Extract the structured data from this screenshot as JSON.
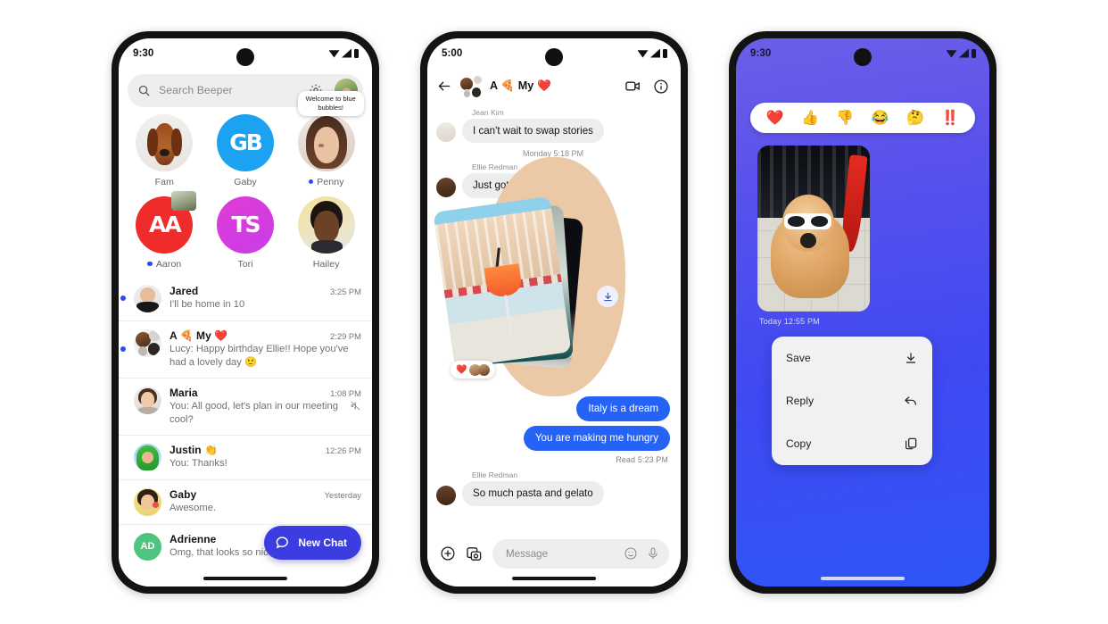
{
  "phone1": {
    "status": {
      "time": "9:30",
      "icons": [
        "wifi-icon",
        "signal-icon",
        "battery-icon"
      ]
    },
    "search": {
      "placeholder": "Search Beeper",
      "icon": "search-icon",
      "settings_icon": "gear-icon",
      "avatar": "profile-avatar"
    },
    "pinned": [
      {
        "name": "Fam",
        "type": "photo",
        "unread": false,
        "badge": null
      },
      {
        "name": "Gaby",
        "type": "initials",
        "initials": "GB",
        "color": "#1ba2f0",
        "unread": false,
        "badge": null
      },
      {
        "name": "Penny",
        "type": "photo",
        "unread": true,
        "badge": "Welcome to blue bubbles!"
      },
      {
        "name": "Aaron",
        "type": "initials",
        "initials": "AA",
        "color": "#ef2b2b",
        "unread": true,
        "badge": null,
        "overlay": "mini-photo"
      },
      {
        "name": "Tori",
        "type": "initials",
        "initials": "TS",
        "color": "#e33bdd",
        "unread": false,
        "badge": null
      },
      {
        "name": "Hailey",
        "type": "photo",
        "unread": false,
        "badge": null
      }
    ],
    "chats": [
      {
        "name": "Jared",
        "time": "3:25 PM",
        "preview": "I'll be home in 10",
        "unread": true,
        "muted": false,
        "avatar_type": "photo"
      },
      {
        "name": "A 🍕 My ❤️",
        "time": "2:29 PM",
        "preview": "Lucy: Happy birthday Ellie!! Hope you've had a lovely day  🙂",
        "unread": true,
        "muted": false,
        "avatar_type": "group"
      },
      {
        "name": "Maria",
        "time": "1:08 PM",
        "preview": "You: All good, let's plan in our meeting cool?",
        "unread": false,
        "muted": true,
        "avatar_type": "photo"
      },
      {
        "name": "Justin 👏",
        "time": "12:26 PM",
        "preview": "You: Thanks!",
        "unread": false,
        "muted": false,
        "avatar_type": "photo"
      },
      {
        "name": "Gaby",
        "time": "Yesterday",
        "preview": "Awesome.",
        "unread": false,
        "muted": false,
        "avatar_type": "photo"
      },
      {
        "name": "Adrienne",
        "time": "",
        "preview": "Omg, that looks so nice!",
        "unread": false,
        "muted": false,
        "avatar_type": "initials",
        "initials": "AD",
        "color": "#4fc47f"
      }
    ],
    "fab": {
      "label": "New Chat",
      "icon": "chat-bubble-icon",
      "color": "#3b3de0"
    }
  },
  "phone2": {
    "status": {
      "time": "5:00"
    },
    "header": {
      "title": "A 🍕 My ❤️",
      "back_icon": "back-arrow-icon",
      "video_icon": "video-call-icon",
      "info_icon": "info-icon"
    },
    "messages": [
      {
        "kind": "incoming",
        "sender": "Jean Kim",
        "text": "I can't wait to swap stories"
      },
      {
        "kind": "daystamp",
        "text": "Monday 5:18 PM"
      },
      {
        "kind": "incoming",
        "sender": "Ellie Redman",
        "text": "Just got back from Rome!"
      },
      {
        "kind": "gallery",
        "download_icon": "download-icon",
        "reaction": "❤️",
        "reaction_avatars": 2
      },
      {
        "kind": "outgoing",
        "text": "Italy is a dream"
      },
      {
        "kind": "outgoing",
        "text": "You are making me hungry"
      },
      {
        "kind": "receipt",
        "text": "Read  5:23 PM"
      },
      {
        "kind": "incoming",
        "sender": "Ellie Redman",
        "text": "So much pasta and gelato"
      }
    ],
    "composer": {
      "placeholder": "Message",
      "plus_icon": "plus-icon",
      "camera_icon": "camera-gallery-icon",
      "emoji_icon": "emoji-icon",
      "mic_icon": "microphone-icon"
    }
  },
  "phone3": {
    "status": {
      "time": "9:30"
    },
    "reactions": [
      "❤️",
      "👍",
      "👎",
      "😂",
      "🤔",
      "‼️"
    ],
    "media": {
      "timestamp": "Today  12:55 PM",
      "alt": "dog-photo"
    },
    "menu": [
      {
        "label": "Save",
        "icon": "download-icon"
      },
      {
        "label": "Reply",
        "icon": "reply-arrow-icon"
      },
      {
        "label": "Copy",
        "icon": "copy-icon"
      }
    ],
    "background": {
      "from": "#6b5fe8",
      "to": "#2f56f7"
    }
  }
}
